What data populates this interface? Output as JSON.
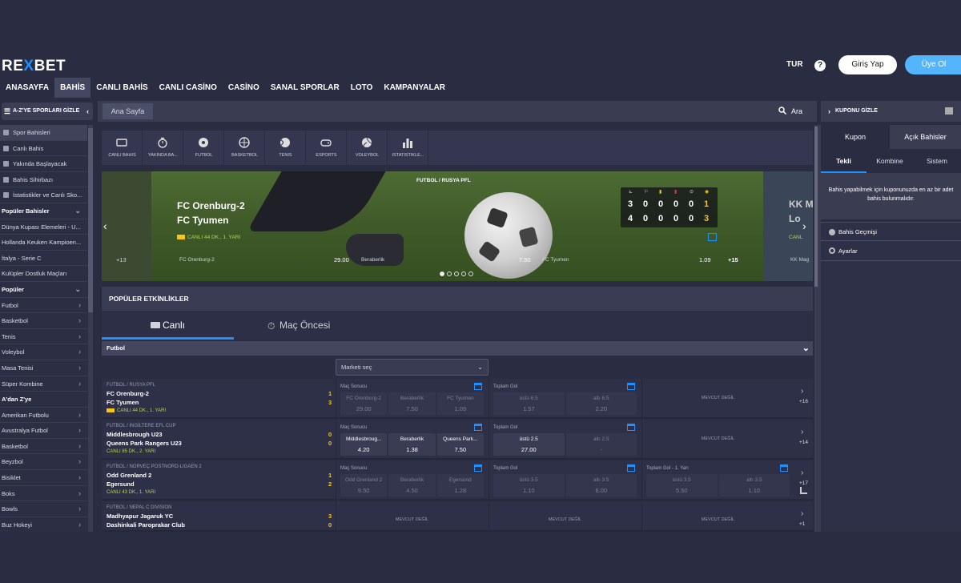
{
  "header": {
    "logo_prefix": "RE",
    "logo_x": "X",
    "logo_suffix": "BET",
    "lang": "TUR",
    "help": "?",
    "login": "Giriş Yap",
    "register": "Üye Ol"
  },
  "nav": [
    "ANASAYFA",
    "BAHİS",
    "CANLI BAHİS",
    "CANLI CASİNO",
    "CASİNO",
    "SANAL SPORLAR",
    "LOTO",
    "KAMPANYALAR"
  ],
  "nav_active": 1,
  "toolbar": {
    "sidebar_toggle": "A-Z'YE SPORLARI GİZLE",
    "breadcrumb": "Ana Sayfa",
    "search": "Ara",
    "coupon_toggle": "KUPONU GİZLE"
  },
  "sidebar": [
    {
      "label": "Spor Bahisleri",
      "type": "sub",
      "icon": "soccer-icon"
    },
    {
      "label": "Canlı Bahis",
      "type": "sub",
      "icon": "live-icon"
    },
    {
      "label": "Yakında Başlayacak",
      "type": "sub",
      "icon": "clock-icon"
    },
    {
      "label": "Bahis Sihirbazı",
      "type": "sub",
      "icon": "wizard-icon"
    },
    {
      "label": "İstatistikler ve Canlı Sko...",
      "type": "sub",
      "icon": "stats-icon"
    },
    {
      "label": "Popüler Bahisler",
      "type": "head",
      "arrow": "⌄"
    },
    {
      "label": "Dünya Kupası Elemeleri - U...",
      "type": "item"
    },
    {
      "label": "Hollanda Keuken Kampioen...",
      "type": "item"
    },
    {
      "label": "İtalya - Serie C",
      "type": "item"
    },
    {
      "label": "Kulüpler Dostluk Maçları",
      "type": "item"
    },
    {
      "label": "Popüler",
      "type": "head",
      "arrow": "⌄"
    },
    {
      "label": "Futbol",
      "type": "item",
      "arrow": "›"
    },
    {
      "label": "Basketbol",
      "type": "item",
      "arrow": "›"
    },
    {
      "label": "Tenis",
      "type": "item",
      "arrow": "›"
    },
    {
      "label": "Voleybol",
      "type": "item",
      "arrow": "›"
    },
    {
      "label": "Masa Tenisi",
      "type": "item",
      "arrow": "›"
    },
    {
      "label": "Süper Kombine",
      "type": "item",
      "arrow": "›"
    },
    {
      "label": "A'dan Z'ye",
      "type": "head"
    },
    {
      "label": "Amerikan Futbolu",
      "type": "item",
      "arrow": "›"
    },
    {
      "label": "Avustralya Futbol",
      "type": "item",
      "arrow": "›"
    },
    {
      "label": "Basketbol",
      "type": "item",
      "arrow": "›"
    },
    {
      "label": "Beyzbol",
      "type": "item",
      "arrow": "›"
    },
    {
      "label": "Bisiklet",
      "type": "item",
      "arrow": "›"
    },
    {
      "label": "Boks",
      "type": "item",
      "arrow": "›"
    },
    {
      "label": "Bowls",
      "type": "item",
      "arrow": "›"
    },
    {
      "label": "Buz Hokeyi",
      "type": "item",
      "arrow": "›"
    }
  ],
  "sports": [
    {
      "label": "CANLI BAHİS",
      "icon": "live-icon"
    },
    {
      "label": "YAKINDA BA...",
      "icon": "stopwatch-icon"
    },
    {
      "label": "FUTBOL",
      "icon": "soccer-ball-icon"
    },
    {
      "label": "BASKETBOL",
      "icon": "basketball-icon"
    },
    {
      "label": "TENİS",
      "icon": "tennis-ball-icon"
    },
    {
      "label": "ESPORTS",
      "icon": "gamepad-icon"
    },
    {
      "label": "VOLEYBOL",
      "icon": "volleyball-icon"
    },
    {
      "label": "İSTATİSTİKLE...",
      "icon": "bar-chart-icon"
    }
  ],
  "banner": {
    "league": "FUTBOL / RUSYA PFL",
    "team1": "FC Orenburg-2",
    "team2": "FC Tyumen",
    "live": "CANLI 44 DK., 1. YARI",
    "odds": [
      {
        "label": "FC Orenburg-2",
        "value": "29.00"
      },
      {
        "label": "Beraberlik",
        "value": "7.50"
      },
      {
        "label": "FC Tyumen",
        "value": "1.09"
      }
    ],
    "more": "+15",
    "prev_more": "+13",
    "scoreboard": {
      "row1": [
        "3",
        "0",
        "0",
        "0",
        "0",
        "1"
      ],
      "row2": [
        "4",
        "0",
        "0",
        "0",
        "0",
        "3"
      ]
    },
    "right_team1": "KK M",
    "right_team2": "Lo",
    "right_live": "CANL",
    "right_odd": "KK Mag"
  },
  "popular": {
    "title": "POPÜLER ETKİNLİKLER",
    "tab_live": "Canlı",
    "tab_pre": "Maç Öncesi",
    "sport": "Futbol",
    "market_select": "Marketi seç"
  },
  "events": [
    {
      "league": "FUTBOL / RUSYA PFL",
      "team1": "FC Orenburg-2",
      "team2": "FC Tyumen",
      "score1": "1",
      "score2": "3",
      "live": "CANLI 44 DK., 1. YARI",
      "m1": {
        "title": "Maç Sonucu",
        "odds": [
          [
            "FC Orenburg-2",
            "29.00",
            true
          ],
          [
            "Beraberlik",
            "7.50",
            true
          ],
          [
            "FC Tyumen",
            "1.09",
            true
          ]
        ]
      },
      "m2": {
        "title": "Toplam Gol",
        "odds": [
          [
            "üstü 6.5",
            "1.57",
            true
          ],
          [
            "altı 6.5",
            "2.20",
            true
          ]
        ]
      },
      "m3": {
        "na": "MEVCUT DEĞİL"
      },
      "more": "+16"
    },
    {
      "league": "FUTBOL / İNGİLTERE EFL CUP",
      "team1": "Middlesbrough U23",
      "team2": "Queens Park Rangers U23",
      "score1": "0",
      "score2": "0",
      "live": "CANLI 85 DK., 2. YARI",
      "m1": {
        "title": "Maç Sonucu",
        "odds": [
          [
            "Middlesbroug...",
            "4.20",
            false
          ],
          [
            "Beraberlik",
            "1.38",
            false
          ],
          [
            "Queens Park...",
            "7.50",
            false
          ]
        ]
      },
      "m2": {
        "title": "Toplam Gol",
        "odds": [
          [
            "üstü 2.5",
            "27.00",
            false
          ],
          [
            "altı 2.5",
            "-",
            true
          ]
        ]
      },
      "m3": {
        "na": "MEVCUT DEĞİL"
      },
      "more": "+14"
    },
    {
      "league": "FUTBOL / NORVEÇ POSTNORD-LIGAEN 2",
      "team1": "Odd Grenland 2",
      "team2": "Egersund",
      "score1": "1",
      "score2": "2",
      "live": "CANLI 43 DK., 1. YARI",
      "m1": {
        "title": "Maç Sonucu",
        "odds": [
          [
            "Odd Grenland 2",
            "9.50",
            true
          ],
          [
            "Beraberlik",
            "4.50",
            true
          ],
          [
            "Egersund",
            "1.28",
            true
          ]
        ]
      },
      "m2": {
        "title": "Toplam Gol",
        "odds": [
          [
            "üstü 3.5",
            "1.10",
            true
          ],
          [
            "altı 3.5",
            "6.00",
            true
          ]
        ]
      },
      "m3": {
        "title": "Toplam Gol - 1. Yarı",
        "odds": [
          [
            "üstü 3.5",
            "5.50",
            true
          ],
          [
            "altı 3.5",
            "1.10",
            true
          ]
        ]
      },
      "more": "+17"
    },
    {
      "league": "FUTBOL / NEPAL C DIVISION",
      "team1": "Madhyapur Jagaruk YC",
      "team2": "Dashinkali Paroprakar Club",
      "score1": "3",
      "score2": "0",
      "live": "",
      "m1": {
        "na": "MEVCUT DEĞİL"
      },
      "m2": {
        "na": "MEVCUT DEĞİL"
      },
      "m3": {
        "na": "MEVCUT DEĞİL"
      },
      "more": "+1"
    }
  ],
  "coupon": {
    "tab_coupon": "Kupon",
    "tab_open": "Açık Bahisler",
    "sub_single": "Tekli",
    "sub_combo": "Kombine",
    "sub_system": "Sistem",
    "empty": "Bahis yapabilmek için kuponunuzda en az bir adet bahis bulunmalıdır.",
    "history": "Bahis Geçmişi",
    "settings": "Ayarlar"
  },
  "colors": {
    "accent": "#1e90ff",
    "live": "#b8d255",
    "score": "#f5c518",
    "bg": "#2a2c42"
  }
}
